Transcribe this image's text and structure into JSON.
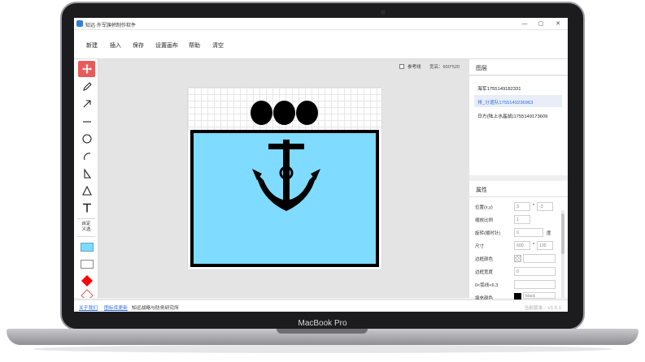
{
  "device": {
    "brand": "MacBook Pro"
  },
  "window": {
    "title": "知远·外军旗帜制作软件",
    "controls": [
      "—",
      "▢",
      "✕"
    ]
  },
  "menu": {
    "items": [
      "新建",
      "插入",
      "保存",
      "设置画布",
      "帮助",
      "清空"
    ]
  },
  "toolbar": {
    "tools": [
      "move-tool",
      "pencil-tool",
      "arrow-tool",
      "line-tool",
      "circle-tool",
      "arc-tool",
      "right-triangle-tool",
      "triangle-tool",
      "text-tool"
    ],
    "custom_shape_label": "自定\n义选",
    "swatches": [
      "#7fdbff",
      "#ffffff",
      "#ff0000",
      "#ffffff"
    ]
  },
  "canvas_options": {
    "reference_line_label": "参考线",
    "size_label": "宽高：600*520"
  },
  "flag": {
    "background_color": "#7fdbff",
    "border_color": "#000000",
    "dots": 3
  },
  "layers": {
    "title": "图层",
    "items": [
      {
        "label": "海军1755149182331",
        "selected": false
      },
      {
        "label": "排_分遣队1755149236963",
        "selected": true
      },
      {
        "label": "日方(陆上水晶鼠)1755149173609",
        "selected": false
      }
    ]
  },
  "properties": {
    "title": "属性",
    "position_label": "位置(x,y)",
    "position_x": "3",
    "position_y": "-3",
    "scale_label": "缩放比例",
    "scale_value": "1",
    "rotation_label": "旋转(顺时针)",
    "rotation_value": "0",
    "rotation_unit": "度",
    "size_label": "尺寸",
    "size_w": "600",
    "size_h": "135",
    "border_color_label": "边框颜色",
    "border_width_label": "边框宽度",
    "border_width_value": "0",
    "arc_label": "0<弧线<6.3",
    "arc_value": "",
    "fill_color_label": "填充颜色",
    "fill_color_value": "black",
    "multiply": "*"
  },
  "statusbar": {
    "about_link": "关于我们",
    "update_link": "图标库更新",
    "org_text": "知远战略与防务研究所",
    "version": "当前版本：V1.5.1"
  }
}
